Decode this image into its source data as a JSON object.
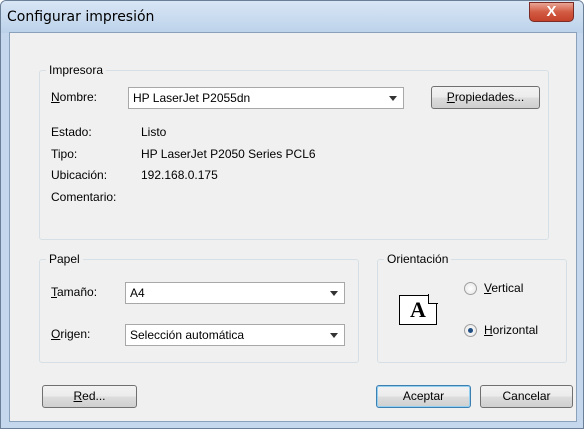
{
  "window": {
    "title": "Configurar impresión",
    "close": "X"
  },
  "printer": {
    "group_label": "Impresora",
    "name_label_accel": "N",
    "name_label_rest": "ombre:",
    "name_value": "HP LaserJet P2055dn",
    "properties_accel": "P",
    "properties_rest": "ropiedades...",
    "status_label": "Estado:",
    "status_value": "Listo",
    "type_label": "Tipo:",
    "type_value": "HP LaserJet P2050 Series PCL6",
    "location_label": "Ubicación:",
    "location_value": "192.168.0.175",
    "comment_label": "Comentario:"
  },
  "paper": {
    "group_label": "Papel",
    "size_label_accel": "T",
    "size_label_rest": "amaño:",
    "size_value": "A4",
    "source_label_accel": "O",
    "source_label_rest": "rigen:",
    "source_value": "Selección automática"
  },
  "orientation": {
    "group_label": "Orientación",
    "icon_letter": "A",
    "vertical_accel": "V",
    "vertical_rest": "ertical",
    "horizontal_accel": "H",
    "horizontal_rest": "orizontal",
    "selected": "horizontal"
  },
  "footer": {
    "network_accel": "R",
    "network_rest": "ed...",
    "ok": "Aceptar",
    "cancel": "Cancelar"
  },
  "colors": {
    "titlebar": "#c4d7ec",
    "client": "#f0f0f0",
    "close": "#c4412a"
  }
}
